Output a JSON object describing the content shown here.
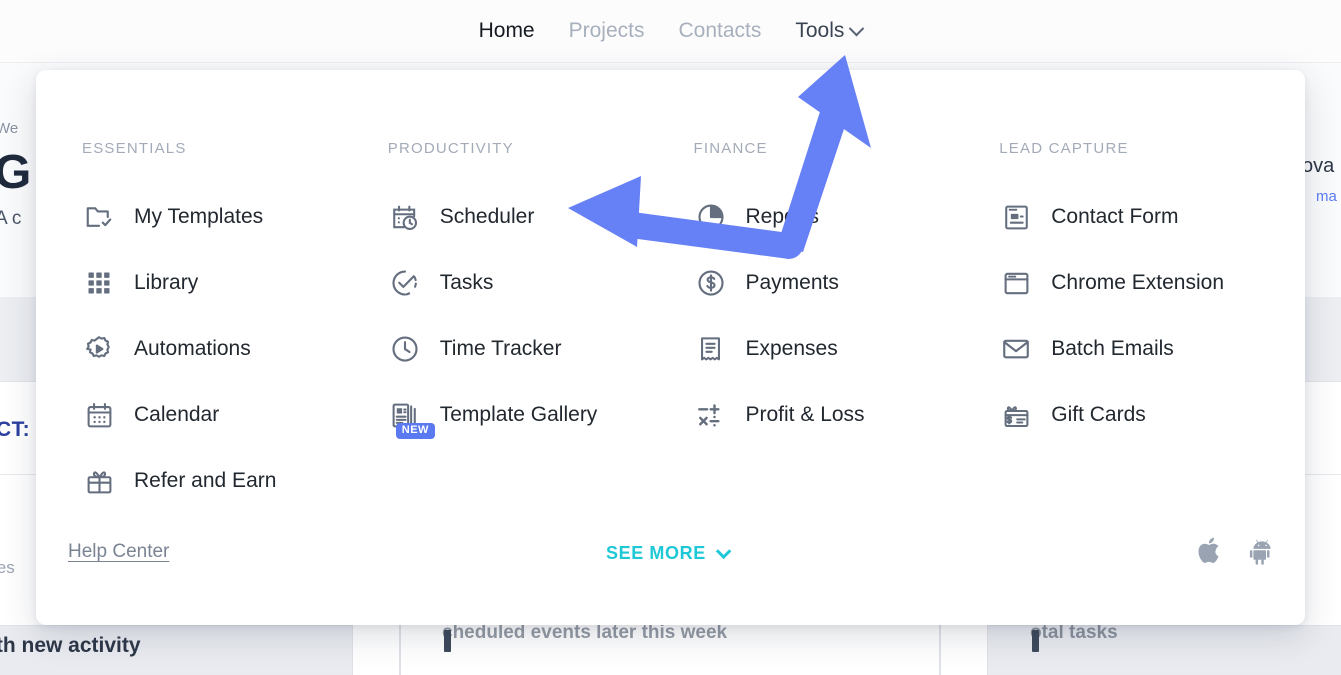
{
  "nav": {
    "items": [
      {
        "label": "Home",
        "state": "active"
      },
      {
        "label": "Projects",
        "state": "inactive"
      },
      {
        "label": "Contacts",
        "state": "inactive"
      },
      {
        "label": "Tools",
        "state": "open",
        "caret": "chevron-down-icon"
      }
    ]
  },
  "menu": {
    "columns": [
      {
        "title": "ESSENTIALS",
        "items": [
          {
            "label": "My Templates",
            "icon": "folder-check-icon"
          },
          {
            "label": "Library",
            "icon": "grid-dots-icon"
          },
          {
            "label": "Automations",
            "icon": "gear-play-icon"
          },
          {
            "label": "Calendar",
            "icon": "calendar-icon"
          },
          {
            "label": "Refer and Earn",
            "icon": "gift-icon"
          }
        ]
      },
      {
        "title": "PRODUCTIVITY",
        "items": [
          {
            "label": "Scheduler",
            "icon": "calendar-clock-icon"
          },
          {
            "label": "Tasks",
            "icon": "check-circle-dashed-icon"
          },
          {
            "label": "Time Tracker",
            "icon": "clock-icon"
          },
          {
            "label": "Template Gallery",
            "icon": "document-stack-icon",
            "badge": "NEW"
          }
        ]
      },
      {
        "title": "FINANCE",
        "items": [
          {
            "label": "Reports",
            "icon": "pie-chart-icon"
          },
          {
            "label": "Payments",
            "icon": "dollar-circle-icon"
          },
          {
            "label": "Expenses",
            "icon": "receipt-icon"
          },
          {
            "label": "Profit & Loss",
            "icon": "math-operators-icon"
          }
        ]
      },
      {
        "title": "LEAD CAPTURE",
        "items": [
          {
            "label": "Contact Form",
            "icon": "form-window-icon"
          },
          {
            "label": "Chrome Extension",
            "icon": "browser-window-icon"
          },
          {
            "label": "Batch Emails",
            "icon": "envelope-icon"
          },
          {
            "label": "Gift Cards",
            "icon": "gift-card-icon"
          }
        ]
      }
    ]
  },
  "footer": {
    "help_center": "Help Center",
    "see_more": "SEE MORE",
    "see_more_caret": "chevron-down-icon",
    "stores": [
      {
        "name": "apple-icon"
      },
      {
        "name": "android-icon"
      }
    ]
  },
  "background": {
    "welcome": "We",
    "big_title": "G",
    "subtitle": "A c",
    "right_dark": "ova",
    "right_blue": "ma",
    "cta": "CT:",
    "ies": "ies",
    "activity": "ith new activity",
    "stat_left": "cheduled events later this week",
    "stat_right": "otal tasks"
  },
  "annotation": {
    "arrow_color": "#6680f5",
    "description": "double-headed-arrow-tools-to-scheduler"
  },
  "colors": {
    "accent_teal": "#1ec8d6",
    "badge_blue": "#5b79f0",
    "arrow_blue": "#6680f5",
    "icon_grey": "#646e7e",
    "text_dark": "#22282f",
    "heading_grey": "#a3abb8"
  }
}
